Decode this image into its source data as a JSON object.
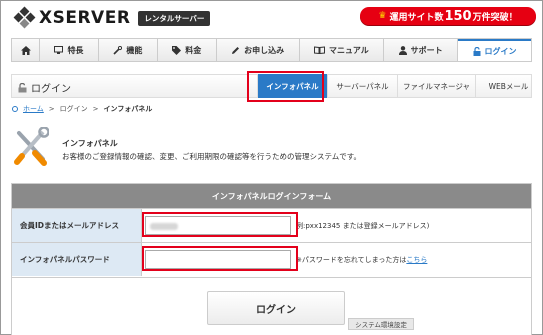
{
  "header": {
    "logo_text": "XSERVER",
    "logo_badge": "レンタルサーバー",
    "promo_prefix": "運用サイト数",
    "promo_number": "150",
    "promo_suffix": "万件突破！"
  },
  "nav": {
    "items": [
      {
        "label": "特長",
        "icon": "monitor-icon"
      },
      {
        "label": "機能",
        "icon": "tools-icon"
      },
      {
        "label": "料金",
        "icon": "tag-icon"
      },
      {
        "label": "お申し込み",
        "icon": "pencil-icon"
      },
      {
        "label": "マニュアル",
        "icon": "book-icon"
      },
      {
        "label": "サポート",
        "icon": "person-icon"
      },
      {
        "label": "ログイン",
        "icon": "lock-icon",
        "active": true
      }
    ]
  },
  "subnav": {
    "title": "ログイン",
    "tabs": [
      {
        "label": "インフォパネル",
        "active": true
      },
      {
        "label": "サーバーパネル"
      },
      {
        "label": "ファイルマネージャ"
      },
      {
        "label": "WEBメール"
      }
    ]
  },
  "breadcrumb": {
    "home": "ホーム",
    "login": "ログイン",
    "current": "インフォパネル"
  },
  "info": {
    "title": "インフォパネル",
    "description": "お客様のご登録情報の確認、変更、ご利用期限の確認等を行うための管理システムです。"
  },
  "form": {
    "heading": "インフォパネルログインフォーム",
    "id_label": "会員IDまたはメールアドレス",
    "id_hint": "例:pxx12345 または登録メールアドレス)",
    "password_label": "インフォパネルパスワード",
    "password_hint_prefix": "※パスワードを忘れてしまった方は",
    "password_hint_link": "こちら",
    "login_button": "ログイン",
    "system_link": "システム環境設定"
  },
  "colors": {
    "accent": "#2a7ac7",
    "highlight": "#e3001b",
    "promo": "#e60012"
  }
}
